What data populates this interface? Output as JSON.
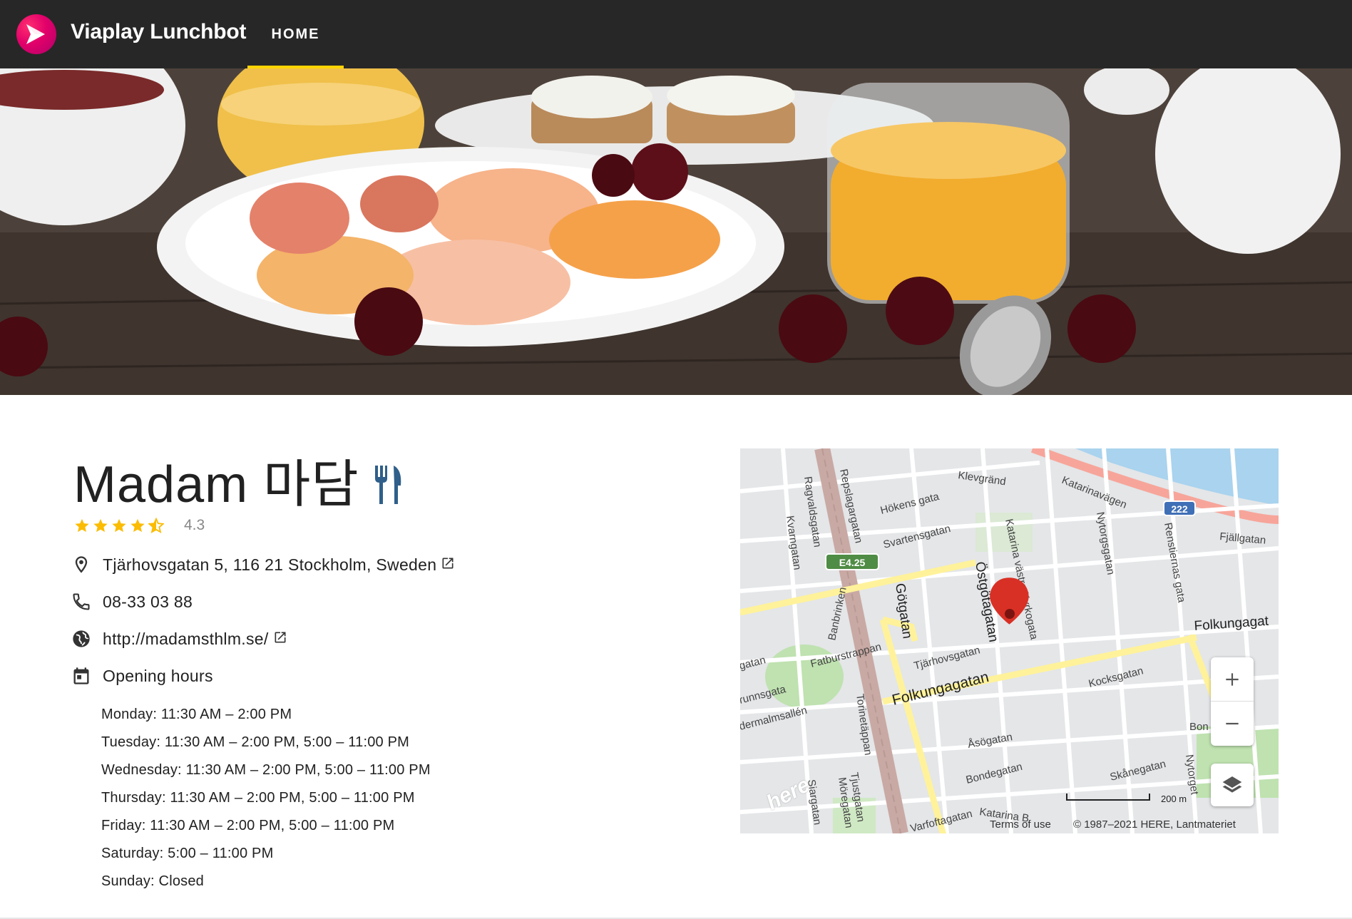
{
  "app": {
    "brand": "Viaplay Lunchbot",
    "nav": {
      "home": "HOME"
    }
  },
  "restaurant": {
    "name": "Madam 마담",
    "rating": 4.3,
    "rating_label": "4.3",
    "address": "Tjärhovsgatan 5, 116 21 Stockholm, Sweden",
    "phone": "08-33 03 88",
    "website": "http://madamsthlm.se/",
    "opening_hours_label": "Opening hours",
    "hours": [
      "Monday: 11:30 AM – 2:00 PM",
      "Tuesday: 11:30 AM – 2:00 PM, 5:00 – 11:00 PM",
      "Wednesday: 11:30 AM – 2:00 PM, 5:00 – 11:00 PM",
      "Thursday: 11:30 AM – 2:00 PM, 5:00 – 11:00 PM",
      "Friday: 11:30 AM – 2:00 PM, 5:00 – 11:00 PM",
      "Saturday: 5:00 – 11:00 PM",
      "Sunday: Closed"
    ]
  },
  "map": {
    "streets": {
      "klevgrand": "Klevgränd",
      "katarinavagen": "Katarinavägen",
      "hokens": "Hökens gata",
      "svartensgatan": "Svartensgatan",
      "nytorgsgatan": "Nytorgsgatan",
      "renstiernas": "Renstiernas gata",
      "fjallgatan": "Fjällgatan",
      "ragvaldsgatan": "Ragvaldsgatan",
      "kvarngatan": "Kvarngatan",
      "repslagargatan": "Repslagargatan",
      "katarina_vastra": "Katarina västra Kyrkogata",
      "ostgotagatan": "Östgötagatan",
      "gotgatan": "Götgatan",
      "banbrinken": "Banbrinken",
      "fatburstrappan": "Fatburstrappan",
      "tjarhovsgatan": "Tjärhovsgatan",
      "folkungagatan": "Folkungagatan",
      "folkungagat_right": "Folkungagat",
      "kocksgatan": "Kocksgatan",
      "asogatan": "Åsögatan",
      "bondegatan": "Bondegatan",
      "skanegatan": "Skånegatan",
      "nytorget": "Nytorget",
      "torinetappan": "Torinetäppan",
      "tjustgatan": "Tjustgatan",
      "moregatan": "Möregatan",
      "siargatan": "Siargatan",
      "varvsgatan": "Varfoftagatan",
      "katarina_b": "Katarina B",
      "dermalmsallen": "dermalmsallén",
      "runnsgata": "runnsgata",
      "gatan_left": "gatan",
      "bon": "Bon",
      "e425": "E4.25",
      "r222": "222"
    },
    "scale_label": "200 m",
    "terms": "Terms of use",
    "copyright": "© 1987–2021 HERE, Lantmateriet",
    "here_logo": "here"
  },
  "colors": {
    "topbar": "#272727",
    "nav_underline": "#ffd400",
    "star": "#fbbc04",
    "brand_logo": "#e2006a",
    "cutlery": "#2f5f8a",
    "marker": "#d93025"
  }
}
